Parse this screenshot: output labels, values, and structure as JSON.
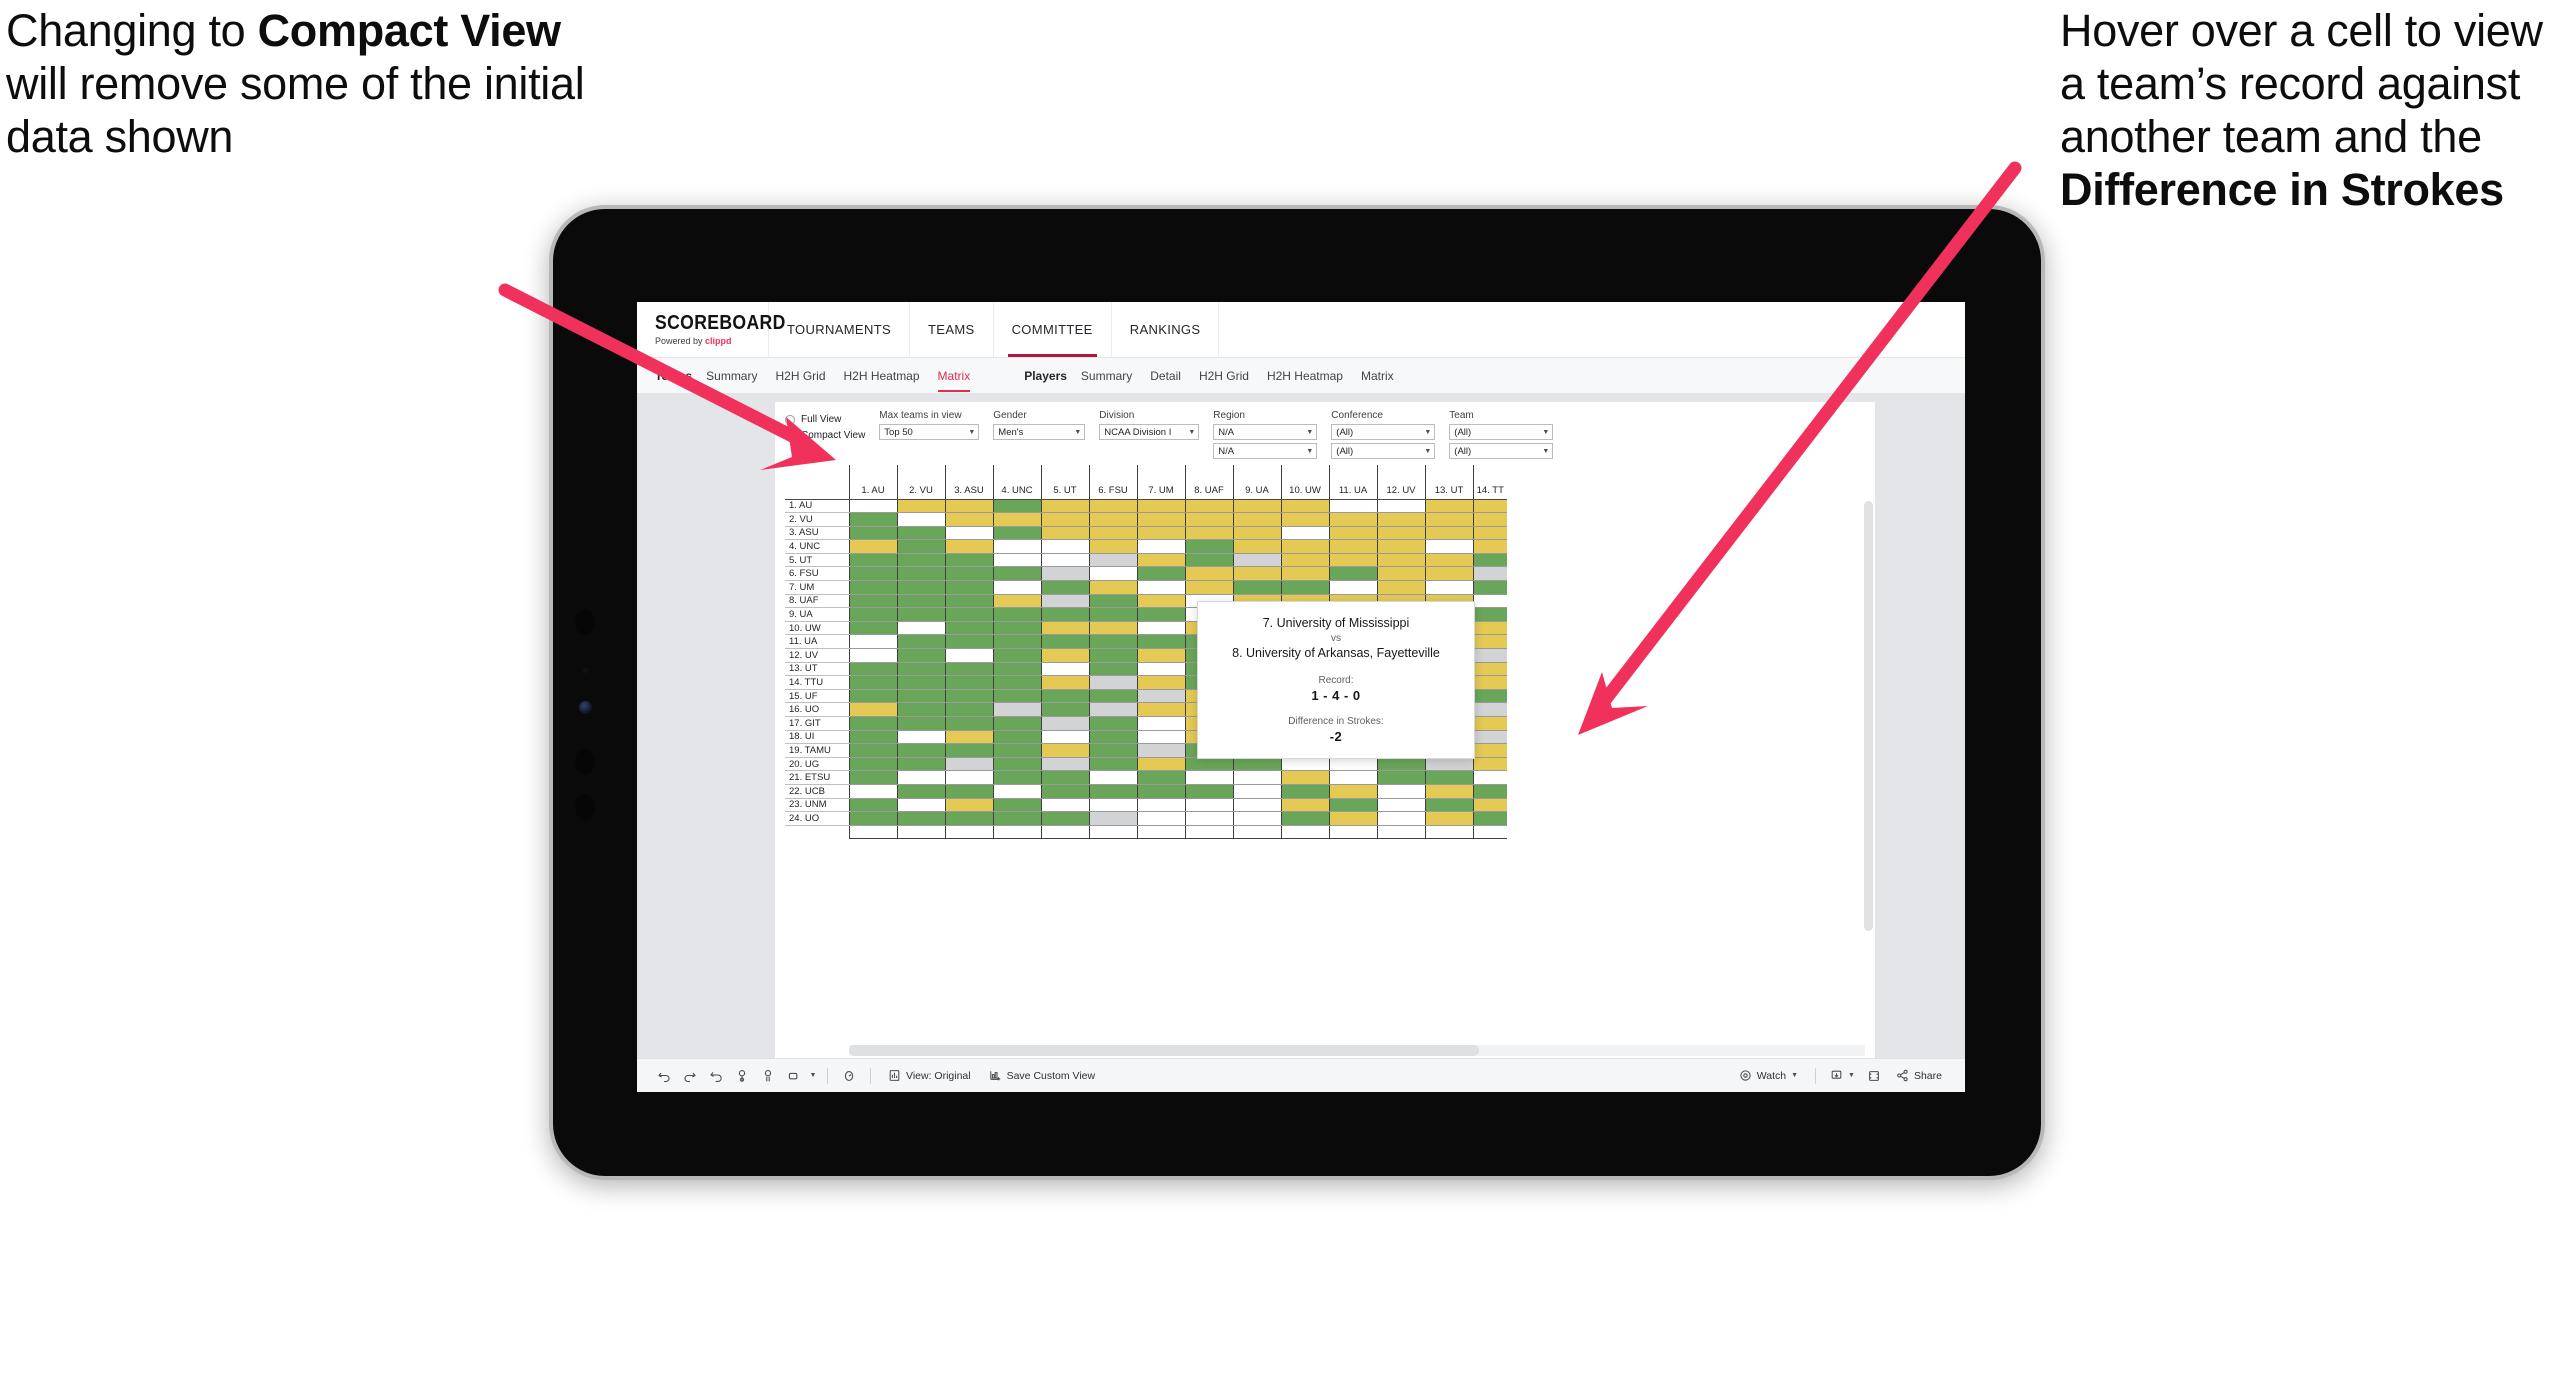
{
  "annotations": {
    "left": {
      "pre": "Changing to ",
      "bold": "Compact View",
      "post": " will remove some of the initial data shown"
    },
    "right": {
      "pre": "Hover over a cell to view a team’s record against another team and the ",
      "bold": "Difference in Strokes",
      "post": ""
    },
    "arrow_color": "#f0315c"
  },
  "brand": {
    "title": "SCOREBOARD",
    "powered_prefix": "Powered by ",
    "powered_name": "clippd"
  },
  "topnav": {
    "items": [
      {
        "label": "TOURNAMENTS",
        "active": false
      },
      {
        "label": "TEAMS",
        "active": false
      },
      {
        "label": "COMMITTEE",
        "active": true
      },
      {
        "label": "RANKINGS",
        "active": false
      }
    ],
    "active_underline_color": "#b01840"
  },
  "subnav": {
    "groups": [
      {
        "label": "Teams",
        "tabs": [
          {
            "label": "Summary",
            "active": false
          },
          {
            "label": "H2H Grid",
            "active": false
          },
          {
            "label": "H2H Heatmap",
            "active": false
          },
          {
            "label": "Matrix",
            "active": true
          }
        ]
      },
      {
        "label": "Players",
        "tabs": [
          {
            "label": "Summary",
            "active": false
          },
          {
            "label": "Detail",
            "active": false
          },
          {
            "label": "H2H Grid",
            "active": false
          },
          {
            "label": "H2H Heatmap",
            "active": false
          },
          {
            "label": "Matrix",
            "active": false
          }
        ]
      }
    ],
    "active_color": "#e02b53"
  },
  "filters": {
    "view_mode": {
      "options": [
        {
          "label": "Full View",
          "selected": false
        },
        {
          "label": "Compact View",
          "selected": true
        }
      ]
    },
    "max_teams": {
      "label": "Max teams in view",
      "value": "Top 50"
    },
    "gender": {
      "label": "Gender",
      "value": "Men's"
    },
    "division": {
      "label": "Division",
      "value": "NCAA Division I"
    },
    "region": {
      "label": "Region",
      "value1": "N/A",
      "value2": "N/A"
    },
    "conference": {
      "label": "Conference",
      "value1": "(All)",
      "value2": "(All)"
    },
    "team": {
      "label": "Team",
      "value1": "(All)",
      "value2": "(All)"
    }
  },
  "matrix": {
    "columns": [
      "1. AU",
      "2. VU",
      "3. ASU",
      "4. UNC",
      "5. UT",
      "6. FSU",
      "7. UM",
      "8. UAF",
      "9. UA",
      "10. UW",
      "11. UA",
      "12. UV",
      "13. UT",
      "14. TT"
    ],
    "rows": [
      "1. AU",
      "2. VU",
      "3. ASU",
      "4. UNC",
      "5. UT",
      "6. FSU",
      "7. UM",
      "8. UAF",
      "9. UA",
      "10. UW",
      "11. UA",
      "12. UV",
      "13. UT",
      "14. TTU",
      "15. UF",
      "16. UO",
      "17. GIT",
      "18. UI",
      "19. TAMU",
      "20. UG",
      "21. ETSU",
      "22. UCB",
      "23. UNM",
      "24. UO"
    ],
    "legend": {
      "win": "#6aa65a",
      "loss": "#e4c954",
      "none": "#ffffff",
      "tie": "#d2d3d4"
    },
    "cells": [
      [
        "w",
        "y",
        "y",
        "g",
        "y",
        "y",
        "y",
        "y",
        "y",
        "y",
        "w",
        "w",
        "y",
        "y"
      ],
      [
        "g",
        "w",
        "y",
        "y",
        "y",
        "y",
        "y",
        "y",
        "y",
        "y",
        "y",
        "y",
        "y",
        "y"
      ],
      [
        "g",
        "g",
        "w",
        "g",
        "y",
        "y",
        "y",
        "y",
        "y",
        "w",
        "y",
        "y",
        "y",
        "y"
      ],
      [
        "y",
        "g",
        "y",
        "w",
        "w",
        "y",
        "w",
        "g",
        "y",
        "y",
        "y",
        "y",
        "w",
        "y"
      ],
      [
        "g",
        "g",
        "g",
        "w",
        "w",
        "s",
        "y",
        "g",
        "s",
        "y",
        "y",
        "y",
        "y",
        "g"
      ],
      [
        "g",
        "g",
        "g",
        "g",
        "s",
        "w",
        "g",
        "y",
        "y",
        "y",
        "g",
        "y",
        "y",
        "s"
      ],
      [
        "g",
        "g",
        "g",
        "w",
        "g",
        "y",
        "w",
        "y",
        "g",
        "g",
        "w",
        "y",
        "w",
        "g"
      ],
      [
        "g",
        "g",
        "g",
        "y",
        "s",
        "g",
        "y",
        "w",
        "y",
        "y",
        "y",
        "y",
        "y",
        "w"
      ],
      [
        "g",
        "g",
        "g",
        "g",
        "g",
        "g",
        "g",
        "w",
        "g",
        "y",
        "y",
        "y",
        "y",
        "g"
      ],
      [
        "g",
        "w",
        "g",
        "g",
        "y",
        "y",
        "w",
        "y",
        "g",
        "w",
        "y",
        "y",
        "y",
        "y"
      ],
      [
        "w",
        "g",
        "g",
        "g",
        "g",
        "g",
        "g",
        "g",
        "y",
        "g",
        "w",
        "y",
        "g",
        "y"
      ],
      [
        "w",
        "g",
        "w",
        "g",
        "y",
        "g",
        "y",
        "g",
        "y",
        "g",
        "y",
        "w",
        "g",
        "s"
      ],
      [
        "g",
        "g",
        "g",
        "g",
        "w",
        "g",
        "w",
        "g",
        "g",
        "g",
        "g",
        "g",
        "w",
        "y"
      ],
      [
        "g",
        "g",
        "g",
        "g",
        "y",
        "s",
        "y",
        "g",
        "g",
        "g",
        "w",
        "g",
        "w",
        "y"
      ],
      [
        "g",
        "g",
        "g",
        "g",
        "g",
        "g",
        "s",
        "y",
        "g",
        "g",
        "w",
        "g",
        "w",
        "g"
      ],
      [
        "y",
        "g",
        "g",
        "s",
        "g",
        "s",
        "y",
        "y",
        "g",
        "g",
        "g",
        "y",
        "y",
        "s"
      ],
      [
        "g",
        "g",
        "g",
        "g",
        "s",
        "g",
        "w",
        "y",
        "y",
        "g",
        "s",
        "y",
        "s",
        "y"
      ],
      [
        "g",
        "w",
        "y",
        "g",
        "w",
        "g",
        "w",
        "y",
        "g",
        "g",
        "w",
        "g",
        "y",
        "s"
      ],
      [
        "g",
        "g",
        "g",
        "g",
        "y",
        "g",
        "s",
        "g",
        "y",
        "g",
        "g",
        "g",
        "s",
        "y"
      ],
      [
        "g",
        "g",
        "s",
        "g",
        "s",
        "g",
        "y",
        "g",
        "g",
        "w",
        "w",
        "g",
        "s",
        "y"
      ],
      [
        "g",
        "w",
        "w",
        "g",
        "g",
        "w",
        "g",
        "w",
        "w",
        "y",
        "w",
        "g",
        "g",
        "w"
      ],
      [
        "w",
        "g",
        "g",
        "w",
        "g",
        "g",
        "g",
        "g",
        "w",
        "g",
        "y",
        "w",
        "y",
        "g"
      ],
      [
        "g",
        "w",
        "y",
        "g",
        "w",
        "w",
        "w",
        "w",
        "w",
        "y",
        "g",
        "w",
        "g",
        "y"
      ],
      [
        "g",
        "g",
        "g",
        "g",
        "g",
        "s",
        "w",
        "w",
        "w",
        "g",
        "y",
        "w",
        "y",
        "g"
      ]
    ]
  },
  "tooltip": {
    "team_a": "7. University of Mississippi",
    "vs": "vs",
    "team_b": "8. University of Arkansas, Fayetteville",
    "record_label": "Record:",
    "record_value": "1 - 4 - 0",
    "diff_label": "Difference in Strokes:",
    "diff_value": "-2"
  },
  "toolbar": {
    "view_original": "View: Original",
    "save_custom_view": "Save Custom View",
    "watch": "Watch",
    "share": "Share"
  }
}
